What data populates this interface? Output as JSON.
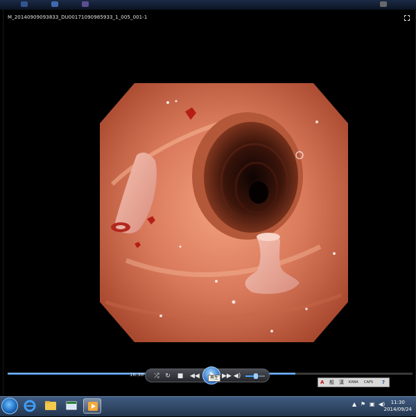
{
  "window": {
    "file_title": "M_20140909093833_DU00171090985933_1_005_001-1"
  },
  "playback": {
    "elapsed_time": "16:38",
    "progress_fraction": 0.71,
    "tooltip": "再生",
    "volume_fraction": 0.55
  },
  "ime_bar": {
    "labels": [
      "A",
      "般",
      "漢",
      "KANA",
      "CAPS"
    ]
  },
  "taskbar": {
    "time": "11:30",
    "date": "2014/09/24"
  },
  "icons": {
    "start": "windows-start-icon",
    "ie": "internet-explorer-icon",
    "explorer": "folder-icon",
    "app3": "window-app-icon",
    "player": "media-player-icon"
  }
}
